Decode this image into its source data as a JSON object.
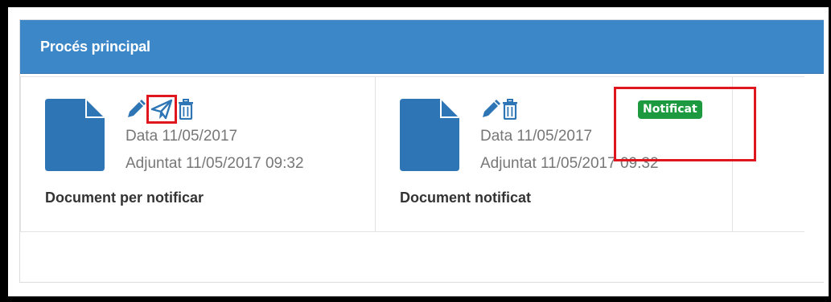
{
  "panel": {
    "title": "Procés principal"
  },
  "documents": [
    {
      "date_text": "Data 11/05/2017",
      "attached_text": "Adjuntat 11/05/2017 09:32",
      "name": "Document per notificar",
      "actions": [
        "pencil-icon",
        "send-icon",
        "trash-icon"
      ]
    },
    {
      "date_text": "Data 11/05/2017",
      "attached_text": "Adjuntat 11/05/2017 09:32",
      "name": "Document notificat",
      "status_badge": "Notificat",
      "actions": [
        "pencil-icon",
        "trash-icon"
      ]
    }
  ],
  "colors": {
    "header_bg": "#3c87c8",
    "icon_blue": "#2e75b6",
    "badge_green": "#1d9a3f",
    "highlight_red": "#e0161f"
  }
}
